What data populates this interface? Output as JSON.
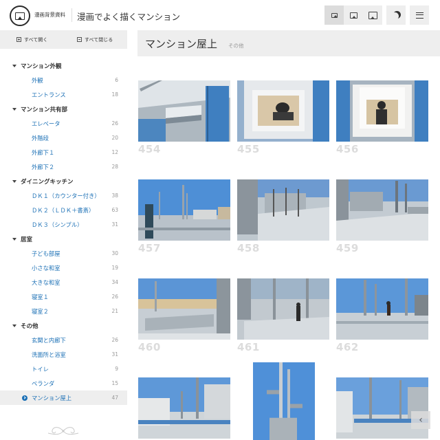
{
  "header": {
    "site_name": "漫画背景資料",
    "page_title": "漫画でよく描くマンション",
    "buttons": [
      {
        "icon": "image-small-icon"
      },
      {
        "icon": "image-medium-icon"
      },
      {
        "icon": "image-large-icon"
      },
      {
        "icon": "moon-icon"
      },
      {
        "icon": "menu-icon"
      }
    ]
  },
  "sidebar": {
    "expand_all": "すべて開く",
    "collapse_all": "すべて閉じる",
    "categories": [
      {
        "label": "マンション外観",
        "items": [
          {
            "label": "外観",
            "count": "6"
          },
          {
            "label": "エントランス",
            "count": "18"
          }
        ]
      },
      {
        "label": "マンション共有部",
        "items": [
          {
            "label": "エレベータ",
            "count": "26"
          },
          {
            "label": "外階段",
            "count": "20"
          },
          {
            "label": "外廊下１",
            "count": "12"
          },
          {
            "label": "外廊下２",
            "count": "28"
          }
        ]
      },
      {
        "label": "ダイニングキッチン",
        "items": [
          {
            "label": "ＤＫ１（カウンター付き）",
            "count": "38"
          },
          {
            "label": "ＤＫ２（ＬＤＫ＋書斎）",
            "count": "63"
          },
          {
            "label": "ＤＫ３（シンプル）",
            "count": "31"
          }
        ]
      },
      {
        "label": "居室",
        "items": [
          {
            "label": "子ども部屋",
            "count": "30"
          },
          {
            "label": "小さな和室",
            "count": "19"
          },
          {
            "label": "大きな和室",
            "count": "34"
          },
          {
            "label": "寝室１",
            "count": "26"
          },
          {
            "label": "寝室２",
            "count": "21"
          }
        ]
      },
      {
        "label": "その他",
        "items": [
          {
            "label": "玄関と内廊下",
            "count": "26"
          },
          {
            "label": "洗面所と浴室",
            "count": "31"
          },
          {
            "label": "トイレ",
            "count": "9"
          },
          {
            "label": "ベランダ",
            "count": "15"
          },
          {
            "label": "マンション屋上",
            "count": "47",
            "active": true
          }
        ]
      }
    ]
  },
  "main": {
    "title": "マンション屋上",
    "parent": "その他",
    "photos": [
      {
        "num": "454",
        "scene": "rooftop-hatch-closed"
      },
      {
        "num": "455",
        "scene": "hatch-open-topdown"
      },
      {
        "num": "456",
        "scene": "hatch-open-person"
      },
      {
        "num": "457",
        "scene": "rooftop-antenna-sky"
      },
      {
        "num": "458",
        "scene": "rooftop-equipment"
      },
      {
        "num": "459",
        "scene": "rooftop-equipment-wide"
      },
      {
        "num": "460",
        "scene": "rooftop-railing"
      },
      {
        "num": "461",
        "scene": "rooftop-person-walkway"
      },
      {
        "num": "462",
        "scene": "rooftop-person-antenna"
      },
      {
        "num": "",
        "scene": "rooftop-antenna-building"
      },
      {
        "num": "",
        "scene": "antenna-pole-vertical"
      },
      {
        "num": "",
        "scene": "rooftop-antenna-corner"
      }
    ]
  }
}
